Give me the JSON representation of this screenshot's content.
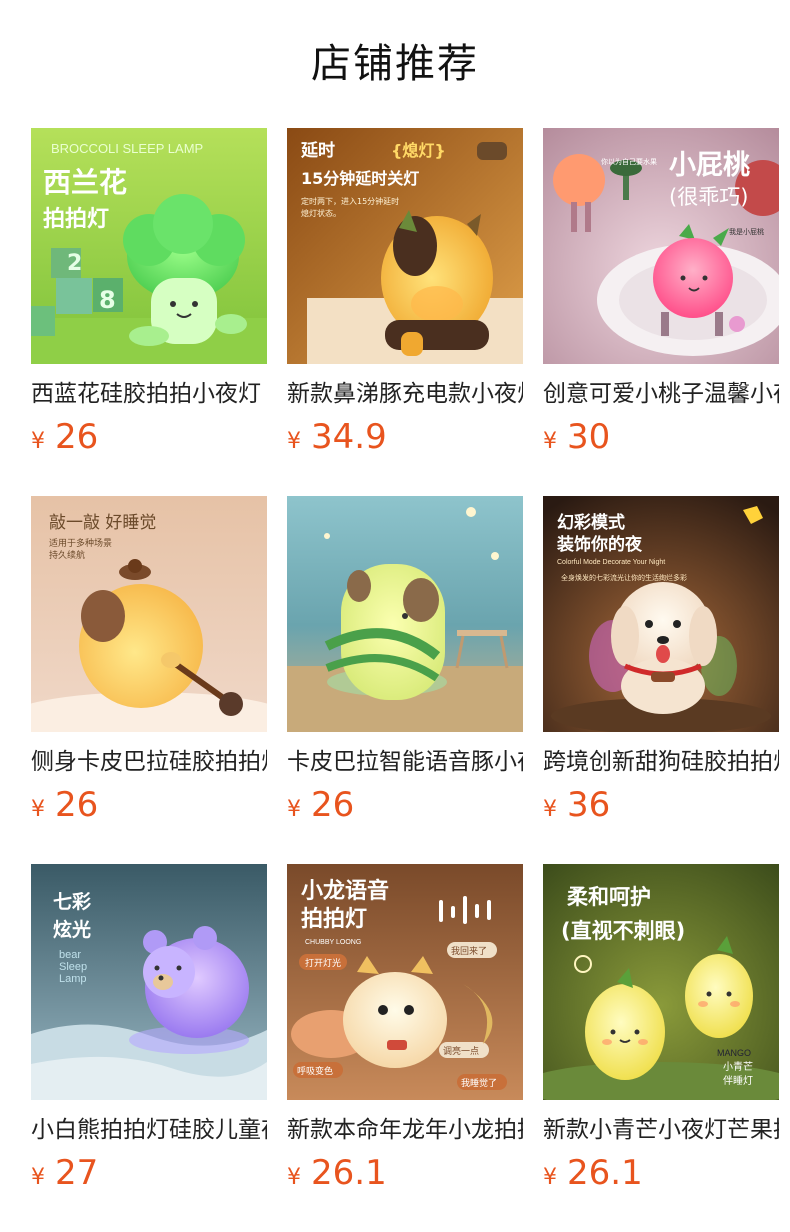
{
  "header": {
    "title": "店铺推荐"
  },
  "currency": "¥",
  "products": [
    {
      "name": "西蓝花硅胶拍拍小夜灯",
      "price": "26",
      "image_texts": [
        "BROCCOLI SLEEP LAMP",
        "西兰花",
        "拍拍灯",
        "2",
        "8"
      ],
      "bg": "#9ed34a"
    },
    {
      "name": "新款鼻涕豚充电款小夜灯",
      "price": "34.9",
      "image_texts": [
        "延时",
        "{熄灯}",
        "15分钟延时关灯",
        "定时两下，进入15分钟延时",
        "熄灯状态。"
      ],
      "bg": "#c98a3c"
    },
    {
      "name": "创意可爱小桃子温馨小夜灯",
      "price": "30",
      "image_texts": [
        "小屁桃",
        "(很乖巧)",
        "你以为自己要水果",
        "我是小屁桃"
      ],
      "bg": "#c9a7b8"
    },
    {
      "name": "侧身卡皮巴拉硅胶拍拍灯",
      "price": "26",
      "image_texts": [
        "敲一敲 好睡觉",
        "适用于多种场景",
        "持久续航"
      ],
      "bg": "#d9b08c"
    },
    {
      "name": "卡皮巴拉智能语音豚小夜灯",
      "price": "26",
      "image_texts": [],
      "bg": "#7fb3bd"
    },
    {
      "name": "跨境创新甜狗硅胶拍拍灯",
      "price": "36",
      "image_texts": [
        "幻彩模式",
        "装饰你的夜",
        "Colorful Mode Decorate Your Night",
        "全身焕发的七彩流光让你的生活绚烂多彩"
      ],
      "bg": "#3a2a22"
    },
    {
      "name": "小白熊拍拍灯硅胶儿童夜灯",
      "price": "27",
      "image_texts": [
        "七彩",
        "炫光",
        "bear",
        "Sleep",
        "Lamp"
      ],
      "bg": "#4a6b78"
    },
    {
      "name": "新款本命年龙年小龙拍拍灯",
      "price": "26.1",
      "image_texts": [
        "小龙语音",
        "拍拍灯",
        "CHUBBY LOONG",
        "打开灯光",
        "我回来了",
        "调亮一点",
        "呼吸变色",
        "我睡觉了"
      ],
      "bg": "#b07a4a"
    },
    {
      "name": "新款小青芒小夜灯芒果拍拍灯",
      "price": "26.1",
      "image_texts": [
        "柔和呵护",
        "(直视不刺眼)",
        "小青芒",
        "伴睡灯",
        "MANGO"
      ],
      "bg": "#6a7a2a"
    }
  ]
}
